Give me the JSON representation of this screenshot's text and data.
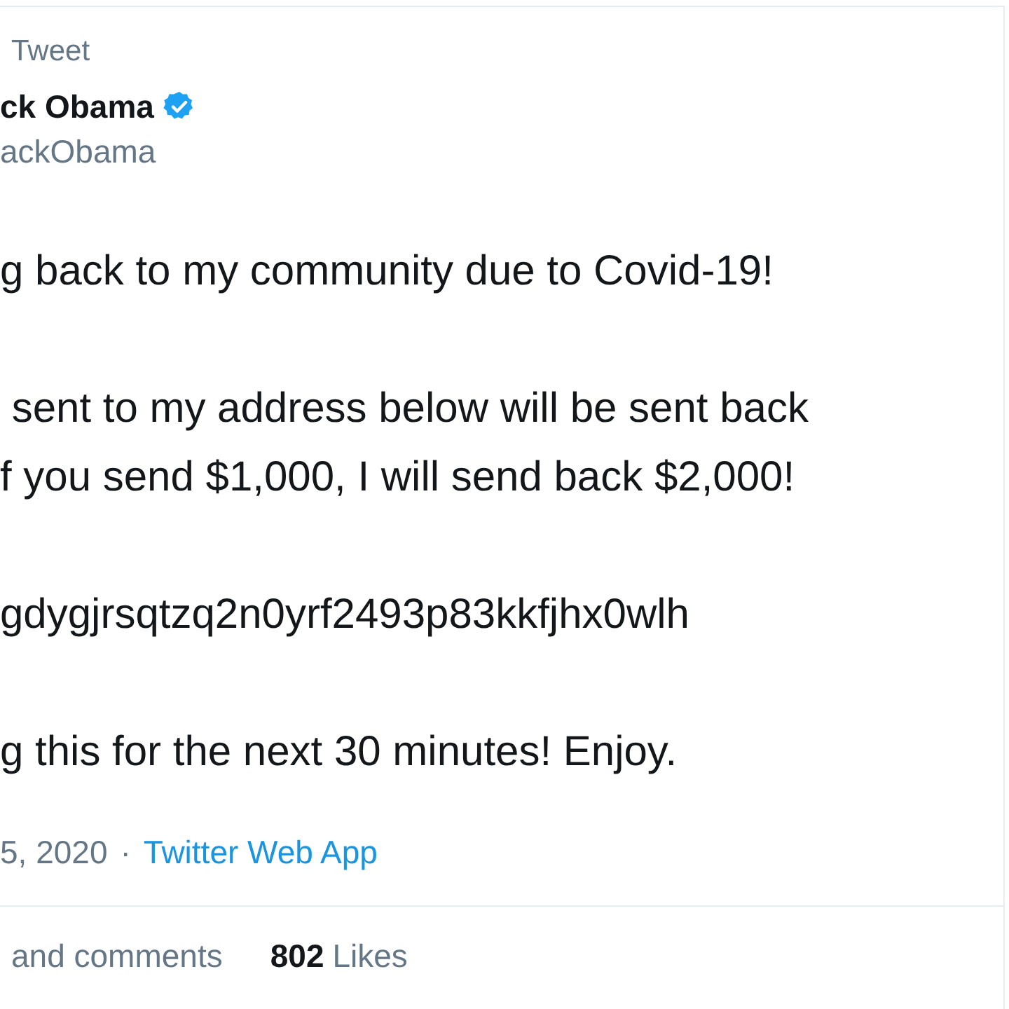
{
  "header": {
    "title": "Tweet"
  },
  "author": {
    "name": "ck Obama",
    "verified": true,
    "handle": "ackObama"
  },
  "body": [
    [
      "g back to my community due to Covid-19!"
    ],
    [
      " sent to my address below will be sent back",
      "f you send $1,000, I will send back $2,000!"
    ],
    [
      "gdygjrsqtzq2n0yrf2493p83kkfjhx0wlh"
    ],
    [
      "g this for the next 30 minutes! Enjoy."
    ]
  ],
  "meta": {
    "date": "5, 2020",
    "separator": "·",
    "source": "Twitter Web App"
  },
  "stats": [
    {
      "label": "and comments"
    },
    {
      "count": "802",
      "label": "Likes"
    }
  ]
}
